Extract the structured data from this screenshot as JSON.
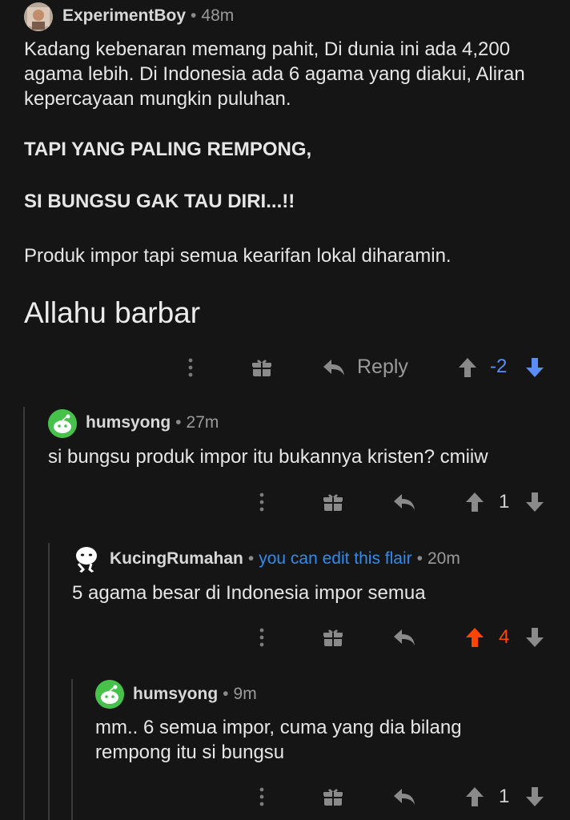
{
  "post": {
    "author": "ExperimentBoy",
    "age": "48m",
    "lines": [
      "Kadang kebenaran memang pahit, Di dunia ini ada 4,200",
      "agama lebih. Di Indonesia ada 6 agama yang diakui, Aliran",
      "kepercayaan mungkin puluhan."
    ],
    "caps1": "TAPI YANG PALING REMPONG,",
    "caps2": "SI BUNGSU GAK TAU DIRI...!!",
    "line_last": "Produk impor tapi semua kearifan lokal diharamin.",
    "heading": "Allahu barbar",
    "reply_label": "Reply",
    "score": "-2"
  },
  "reply1": {
    "author": "humsyong",
    "age": "27m",
    "text": "si bungsu produk impor itu bukannya kristen? cmiiw",
    "score": "1"
  },
  "reply2": {
    "author": "KucingRumahan",
    "flair": "you can edit this flair",
    "age": "20m",
    "text": "5 agama besar di Indonesia impor semua",
    "score": "4"
  },
  "reply3": {
    "author": "humsyong",
    "age": "9m",
    "lines": [
      "mm.. 6 semua impor, cuma yang dia bilang",
      "rempong itu si bungsu"
    ],
    "score": "1"
  },
  "colors": {
    "background": "#151516",
    "downvote_active": "#5b8cf7",
    "upvote_active": "#ff4500",
    "flair": "#2d8cf0",
    "avatar_green": "#46c24b"
  }
}
